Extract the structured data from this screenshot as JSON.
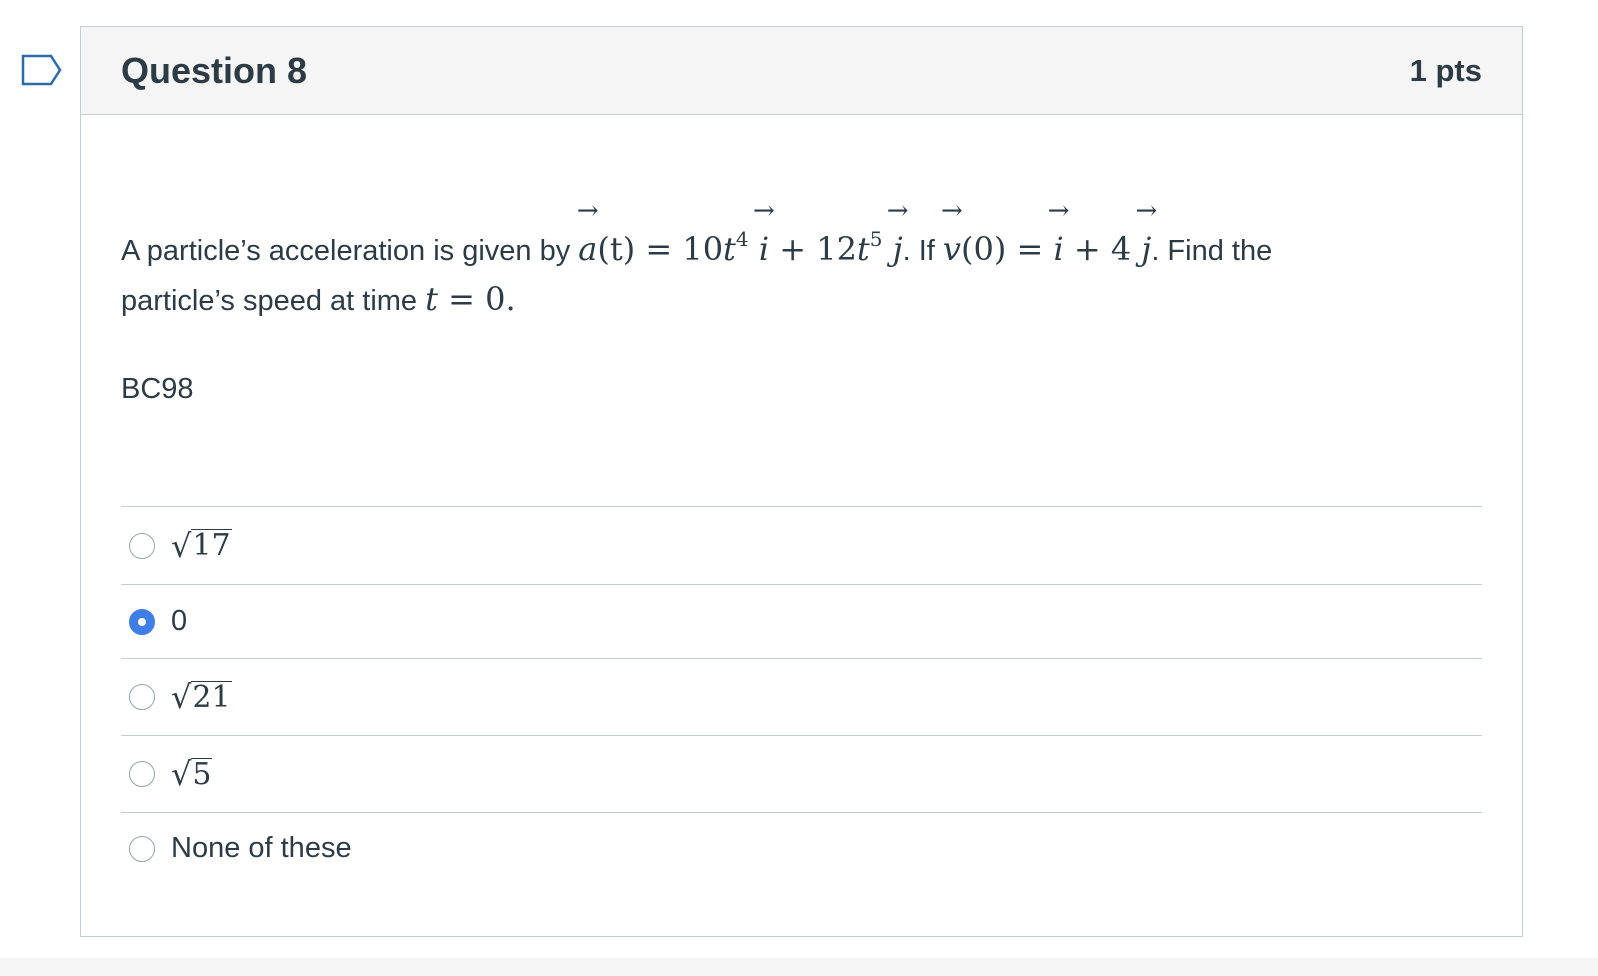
{
  "question": {
    "title": "Question 8",
    "points": "1 pts",
    "text": {
      "intro": "A particle’s acceleration is given by",
      "a_vec": "a",
      "t_paren": "(t)",
      "eq1": "=",
      "coef1": "10",
      "t1": "t",
      "exp1": "4",
      "i1": "i",
      "plus1": "+",
      "coef2": "12",
      "t2": "t",
      "exp2": "5",
      "j1": "j",
      "if_text": ". If",
      "v_vec": "v",
      "zero_paren": "(0)",
      "eq2": "=",
      "i2": "i",
      "plus2": "+",
      "coef3": "4",
      "j2": "j",
      "find_text": ". Find the",
      "line2": "particle’s speed at time",
      "t3": "t",
      "eq3": "=",
      "zero_end": "0.",
      "arrow": "→"
    },
    "code": "BC98",
    "answers": [
      {
        "radical": "√",
        "value": "17",
        "selected": false
      },
      {
        "text": "0",
        "selected": true
      },
      {
        "radical": "√",
        "value": "21",
        "selected": false
      },
      {
        "radical": "√",
        "value": "5",
        "selected": false
      },
      {
        "text": "None of these",
        "selected": false
      }
    ]
  },
  "colors": {
    "accent": "#3e7ee6",
    "header_bg": "#f5f5f5",
    "border": "#c7cdd1",
    "text": "#2d3b45"
  },
  "icons": {
    "flag": "bookmark-flag-icon"
  }
}
